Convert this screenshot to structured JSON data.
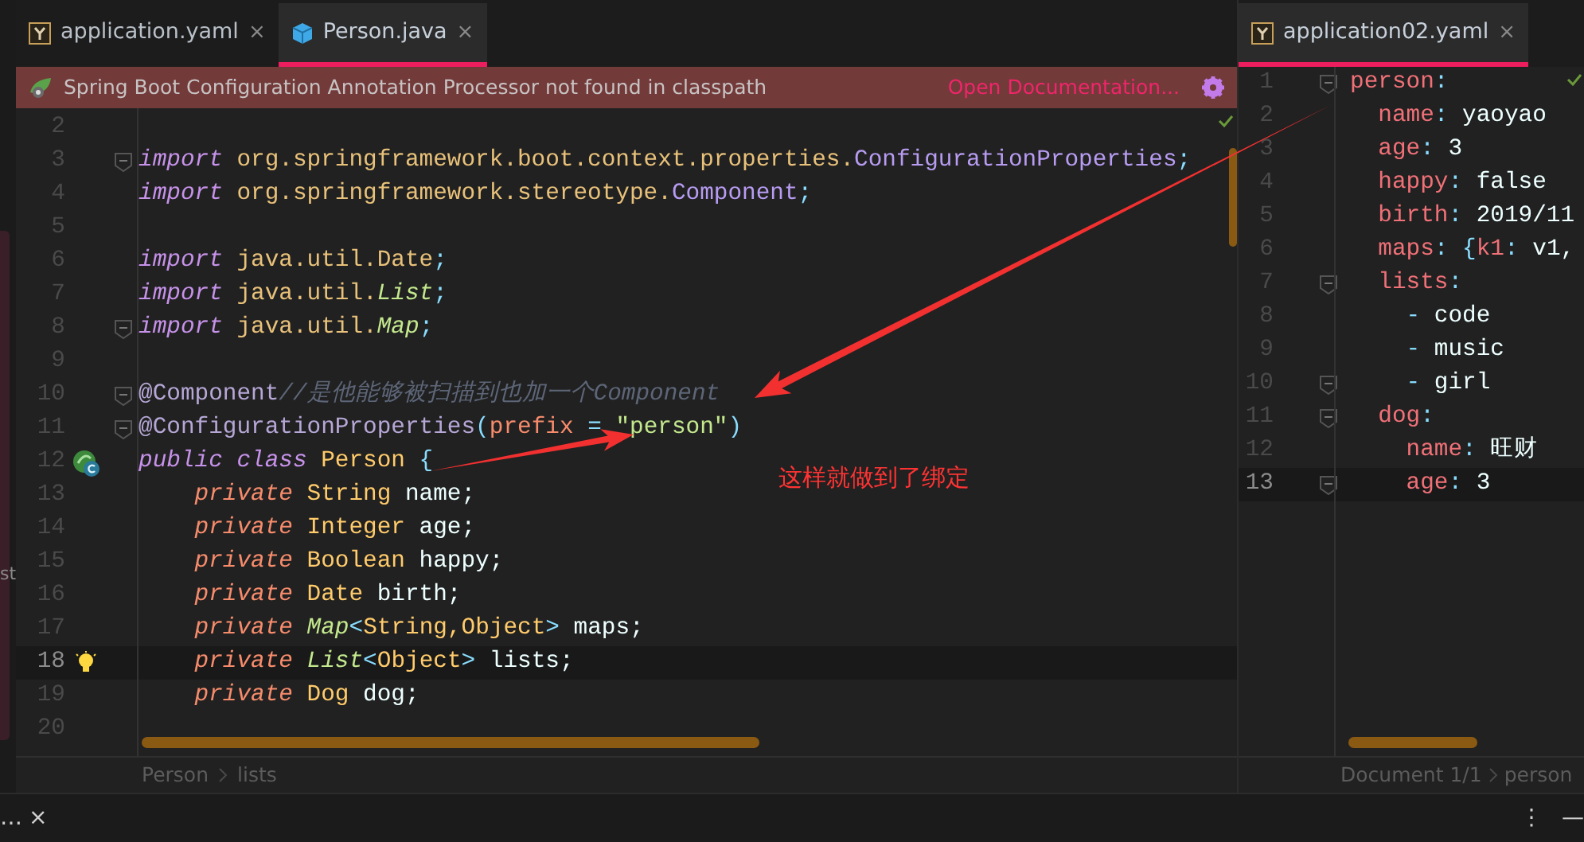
{
  "side_fragment": "st",
  "left_editor": {
    "tabs": [
      {
        "label": "application.yaml",
        "kind": "yaml",
        "selected": false,
        "close": "×"
      },
      {
        "label": "Person.java",
        "kind": "java",
        "selected": true,
        "close": "×"
      }
    ],
    "banner": {
      "message": "Spring Boot Configuration Annotation Processor not found in classpath",
      "link": "Open Documentation..."
    },
    "lines": [
      {
        "number": "2",
        "current": false,
        "fold": false
      },
      {
        "number": "3",
        "current": false,
        "fold": true,
        "tokens": [
          {
            "text": "import",
            "kind": "kw"
          },
          {
            "text": " org.springframework.boot.context.properties.",
            "kind": "pkg"
          },
          {
            "text": "ConfigurationProperties",
            "kind": "cls"
          },
          {
            "text": ";",
            "kind": "punct"
          }
        ]
      },
      {
        "number": "4",
        "current": false,
        "fold": false,
        "tokens": [
          {
            "text": "import",
            "kind": "kw"
          },
          {
            "text": " org.springframework.stereotype.",
            "kind": "pkg"
          },
          {
            "text": "Component",
            "kind": "cls"
          },
          {
            "text": ";",
            "kind": "punct"
          }
        ]
      },
      {
        "number": "5",
        "current": false,
        "fold": false
      },
      {
        "number": "6",
        "current": false,
        "fold": false,
        "tokens": [
          {
            "text": "import",
            "kind": "kw"
          },
          {
            "text": " java.util.Date",
            "kind": "pkg"
          },
          {
            "text": ";",
            "kind": "punct"
          }
        ]
      },
      {
        "number": "7",
        "current": false,
        "fold": false,
        "tokens": [
          {
            "text": "import",
            "kind": "kw"
          },
          {
            "text": " java.util.",
            "kind": "pkg"
          },
          {
            "text": "List",
            "kind": "iface"
          },
          {
            "text": ";",
            "kind": "punct"
          }
        ]
      },
      {
        "number": "8",
        "current": false,
        "fold": true,
        "tokens": [
          {
            "text": "import",
            "kind": "kw"
          },
          {
            "text": " java.util.",
            "kind": "pkg"
          },
          {
            "text": "Map",
            "kind": "iface"
          },
          {
            "text": ";",
            "kind": "punct"
          }
        ]
      },
      {
        "number": "9",
        "current": false,
        "fold": false
      },
      {
        "number": "10",
        "current": false,
        "fold": true,
        "tokens": [
          {
            "text": "@Component",
            "kind": "ann"
          },
          {
            "text": "//是他能够被扫描到也加一个Component",
            "kind": "comment"
          }
        ]
      },
      {
        "number": "11",
        "current": false,
        "fold": true,
        "tokens": [
          {
            "text": "@ConfigurationProperties",
            "kind": "ann"
          },
          {
            "text": "(",
            "kind": "punct"
          },
          {
            "text": "prefix",
            "kind": "param"
          },
          {
            "text": " = ",
            "kind": "punct"
          },
          {
            "text": "\"person\"",
            "kind": "str"
          },
          {
            "text": ")",
            "kind": "punct"
          }
        ]
      },
      {
        "number": "12",
        "current": false,
        "fold": false,
        "marker": {
          "kind": "bean"
        },
        "tokens": [
          {
            "text": "public class",
            "kind": "kw"
          },
          {
            "text": " Person ",
            "kind": "type"
          },
          {
            "text": "{",
            "kind": "punct"
          }
        ]
      },
      {
        "number": "13",
        "current": false,
        "fold": false,
        "tokens": [
          {
            "text": "    private",
            "kind": "mod"
          },
          {
            "text": " String",
            "kind": "type"
          },
          {
            "text": " name;",
            "kind": "ident"
          }
        ]
      },
      {
        "number": "14",
        "current": false,
        "fold": false,
        "tokens": [
          {
            "text": "    private",
            "kind": "mod"
          },
          {
            "text": " Integer",
            "kind": "type"
          },
          {
            "text": " age;",
            "kind": "ident"
          }
        ]
      },
      {
        "number": "15",
        "current": false,
        "fold": false,
        "tokens": [
          {
            "text": "    private",
            "kind": "mod"
          },
          {
            "text": " Boolean",
            "kind": "type"
          },
          {
            "text": " happy;",
            "kind": "ident"
          }
        ]
      },
      {
        "number": "16",
        "current": false,
        "fold": false,
        "tokens": [
          {
            "text": "    private",
            "kind": "mod"
          },
          {
            "text": " Date",
            "kind": "type"
          },
          {
            "text": " birth;",
            "kind": "ident"
          }
        ]
      },
      {
        "number": "17",
        "current": false,
        "fold": false,
        "tokens": [
          {
            "text": "    private ",
            "kind": "mod"
          },
          {
            "text": "Map",
            "kind": "iface"
          },
          {
            "text": "<",
            "kind": "punct"
          },
          {
            "text": "String,Object",
            "kind": "type"
          },
          {
            "text": ">",
            "kind": "punct"
          },
          {
            "text": " maps;",
            "kind": "ident"
          }
        ]
      },
      {
        "number": "18",
        "current": true,
        "fold": false,
        "marker": {
          "kind": "bulb"
        },
        "tokens": [
          {
            "text": "    private ",
            "kind": "mod"
          },
          {
            "text": "List",
            "kind": "iface"
          },
          {
            "text": "<",
            "kind": "punct"
          },
          {
            "text": "Object",
            "kind": "type"
          },
          {
            "text": ">",
            "kind": "punct"
          },
          {
            "text": " lists;",
            "kind": "ident"
          }
        ]
      },
      {
        "number": "19",
        "current": false,
        "fold": false,
        "tokens": [
          {
            "text": "    private",
            "kind": "mod"
          },
          {
            "text": " Dog",
            "kind": "type"
          },
          {
            "text": " dog;",
            "kind": "ident"
          }
        ]
      },
      {
        "number": "20",
        "current": false,
        "fold": false
      }
    ],
    "breadcrumb": [
      "Person",
      "lists"
    ]
  },
  "right_editor": {
    "tabs": [
      {
        "label": "application02.yaml",
        "kind": "yaml",
        "selected": true,
        "close": "×"
      }
    ],
    "lines": [
      {
        "number": "1",
        "current": false,
        "fold": true,
        "tokens": [
          {
            "text": "person",
            "kind": "key"
          },
          {
            "text": ":",
            "kind": "punct"
          }
        ]
      },
      {
        "number": "2",
        "current": false,
        "fold": false,
        "tokens": [
          {
            "text": "  name",
            "kind": "key"
          },
          {
            "text": ":",
            "kind": "punct"
          },
          {
            "text": " yaoyao",
            "kind": "ident"
          }
        ]
      },
      {
        "number": "3",
        "current": false,
        "fold": false,
        "tokens": [
          {
            "text": "  age",
            "kind": "key"
          },
          {
            "text": ":",
            "kind": "punct"
          },
          {
            "text": " 3",
            "kind": "ident"
          }
        ]
      },
      {
        "number": "4",
        "current": false,
        "fold": false,
        "tokens": [
          {
            "text": "  happy",
            "kind": "key"
          },
          {
            "text": ":",
            "kind": "punct"
          },
          {
            "text": " false",
            "kind": "ident"
          }
        ]
      },
      {
        "number": "5",
        "current": false,
        "fold": false,
        "tokens": [
          {
            "text": "  birth",
            "kind": "key"
          },
          {
            "text": ":",
            "kind": "punct"
          },
          {
            "text": " 2019/11",
            "kind": "ident"
          }
        ]
      },
      {
        "number": "6",
        "current": false,
        "fold": false,
        "tokens": [
          {
            "text": "  maps",
            "kind": "key"
          },
          {
            "text": ": {",
            "kind": "punct"
          },
          {
            "text": "k1",
            "kind": "key"
          },
          {
            "text": ":",
            "kind": "punct"
          },
          {
            "text": " v1,",
            "kind": "ident"
          }
        ]
      },
      {
        "number": "7",
        "current": false,
        "fold": true,
        "tokens": [
          {
            "text": "  lists",
            "kind": "key"
          },
          {
            "text": ":",
            "kind": "punct"
          }
        ]
      },
      {
        "number": "8",
        "current": false,
        "fold": false,
        "tokens": [
          {
            "text": "    - ",
            "kind": "punct"
          },
          {
            "text": "code",
            "kind": "ident"
          }
        ]
      },
      {
        "number": "9",
        "current": false,
        "fold": false,
        "tokens": [
          {
            "text": "    - ",
            "kind": "punct"
          },
          {
            "text": "music",
            "kind": "ident"
          }
        ]
      },
      {
        "number": "10",
        "current": false,
        "fold": true,
        "tokens": [
          {
            "text": "    - ",
            "kind": "punct"
          },
          {
            "text": "girl",
            "kind": "ident"
          }
        ]
      },
      {
        "number": "11",
        "current": false,
        "fold": true,
        "tokens": [
          {
            "text": "  dog",
            "kind": "key"
          },
          {
            "text": ":",
            "kind": "punct"
          }
        ]
      },
      {
        "number": "12",
        "current": false,
        "fold": false,
        "tokens": [
          {
            "text": "    name",
            "kind": "key"
          },
          {
            "text": ": ",
            "kind": "punct"
          },
          {
            "text": "旺财",
            "kind": "ident"
          }
        ]
      },
      {
        "number": "13",
        "current": true,
        "fold": true,
        "tokens": [
          {
            "text": "    age",
            "kind": "key"
          },
          {
            "text": ":",
            "kind": "punct"
          },
          {
            "text": " 3",
            "kind": "ident"
          }
        ]
      }
    ],
    "breadcrumb": [
      "Document 1/1",
      "person"
    ]
  },
  "annotation": {
    "text": "这样就做到了绑定"
  },
  "bottom_bar": {
    "left_text": "…",
    "close": "×",
    "menu": "⋮",
    "minimize": "—"
  }
}
